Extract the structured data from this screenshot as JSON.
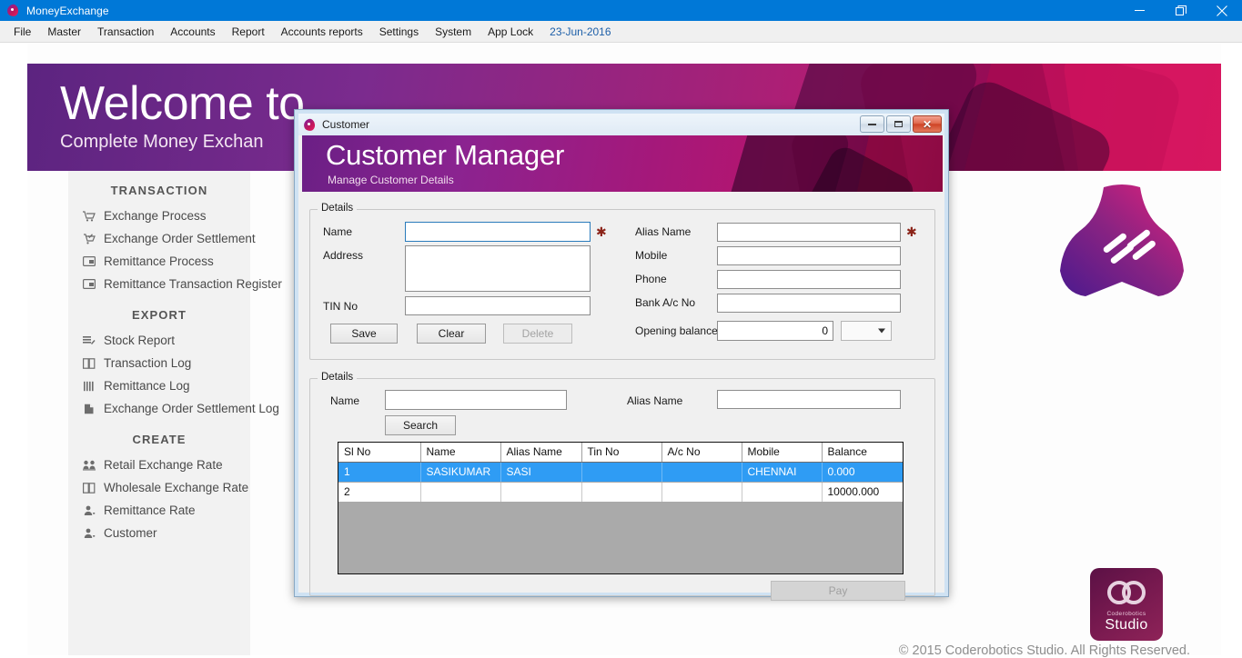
{
  "window": {
    "title": "MoneyExchange",
    "controls": {
      "minimize": "minimize-icon",
      "maximize": "maximize-icon",
      "close": "close-icon"
    }
  },
  "menubar": {
    "items": [
      {
        "label": "File"
      },
      {
        "label": "Master"
      },
      {
        "label": "Transaction"
      },
      {
        "label": "Accounts"
      },
      {
        "label": "Report"
      },
      {
        "label": "Accounts reports"
      },
      {
        "label": "Settings"
      },
      {
        "label": "System"
      },
      {
        "label": "App Lock"
      },
      {
        "label": "23-Jun-2016"
      }
    ]
  },
  "banner": {
    "title": "Welcome to",
    "subtitle": "Complete Money Exchan"
  },
  "sidebar": {
    "groups": [
      {
        "title": "TRANSACTION",
        "items": [
          {
            "label": "Exchange Process",
            "icon": "cart-icon"
          },
          {
            "label": "Exchange Order Settlement",
            "icon": "cart-check-icon"
          },
          {
            "label": "Remittance Process",
            "icon": "card-icon"
          },
          {
            "label": "Remittance Transaction Register",
            "icon": "card-icon"
          }
        ]
      },
      {
        "title": "EXPORT",
        "items": [
          {
            "label": "Stock Report",
            "icon": "stack-icon"
          },
          {
            "label": "Transaction Log",
            "icon": "book-icon"
          },
          {
            "label": "Remittance Log",
            "icon": "bars-icon"
          },
          {
            "label": "Exchange Order Settlement Log",
            "icon": "page-icon"
          }
        ]
      },
      {
        "title": "CREATE",
        "items": [
          {
            "label": "Retail Exchange Rate",
            "icon": "people-icon"
          },
          {
            "label": "Wholesale Exchange Rate",
            "icon": "book-icon"
          },
          {
            "label": "Remittance Rate",
            "icon": "person-icon"
          },
          {
            "label": "Customer",
            "icon": "person-icon"
          }
        ]
      }
    ]
  },
  "brand": {
    "logo": "trilobe-logo-icon",
    "badge_line1": "Coderobotics",
    "badge_line2": "Studio",
    "badge_icon": "coderobotics-cc-icon"
  },
  "footer": {
    "copyright": "© 2015 Coderobotics Studio. All Rights Reserved."
  },
  "dialog": {
    "titlebar_title": "Customer",
    "heading": "Customer Manager",
    "subheading": "Manage Customer Details",
    "details_group": {
      "legend": "Details",
      "labels": {
        "name": "Name",
        "address": "Address",
        "tin_no": "TIN No",
        "alias_name": "Alias Name",
        "mobile": "Mobile",
        "phone": "Phone",
        "bank_ac_no": "Bank A/c No",
        "opening_balance": "Opening balance"
      },
      "values": {
        "name": "",
        "address": "",
        "tin_no": "",
        "alias_name": "",
        "mobile": "",
        "phone": "",
        "bank_ac_no": "",
        "opening_balance": "0",
        "currency": ""
      },
      "required_marker": "✱",
      "buttons": {
        "save": "Save",
        "clear": "Clear",
        "delete": "Delete"
      }
    },
    "search_group": {
      "legend": "Details",
      "labels": {
        "name": "Name",
        "alias_name": "Alias Name"
      },
      "values": {
        "name": "",
        "alias_name": ""
      },
      "search_button": "Search",
      "pay_button": "Pay",
      "grid": {
        "columns": [
          "Sl No",
          "Name",
          "Alias Name",
          "Tin No",
          "A/c No",
          "Mobile",
          "Balance"
        ],
        "rows": [
          {
            "selected": true,
            "cells": [
              "1",
              "SASIKUMAR",
              "SASI",
              "",
              "",
              "CHENNAI",
              "0.000"
            ]
          },
          {
            "selected": false,
            "cells": [
              "2",
              "",
              "",
              "",
              "",
              "",
              "10000.000"
            ]
          }
        ]
      }
    }
  },
  "colors": {
    "titlebar": "#0078d7",
    "accent_link": "#1d5fa8",
    "grid_selection": "#2f9cf4",
    "required": "#8b2318"
  }
}
